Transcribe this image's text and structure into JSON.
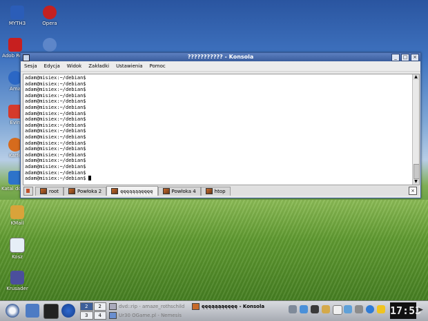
{
  "desktop": {
    "icons": [
      {
        "label": "MYTH3",
        "color": "#2b5db8"
      },
      {
        "label": "Opera",
        "color": "#c42121"
      },
      {
        "label": "Adob Read",
        "color": "#c71f1f"
      },
      {
        "label": "Ama",
        "color": "#2b67c5"
      },
      {
        "label": "Evin",
        "color": "#d53a2b"
      },
      {
        "label": "Kaffe",
        "color": "#d66b1d"
      },
      {
        "label": "Katal domu",
        "color": "#2d73c9"
      },
      {
        "label": "KMail",
        "color": "#d9a33a"
      },
      {
        "label": "Kosz",
        "color": "#e6eef7"
      },
      {
        "label": "Krusader",
        "color": "#4b4f9c"
      }
    ]
  },
  "window": {
    "title": "??????????? - Konsola",
    "menu": [
      "Sesja",
      "Edycja",
      "Widok",
      "Zakładki",
      "Ustawienia",
      "Pomoc"
    ],
    "terminal_lines": [
      "adam@misiex:~/debian$",
      "adam@misiex:~/debian$",
      "adam@misiex:~/debian$",
      "adam@misiex:~/debian$",
      "adam@misiex:~/debian$",
      "adam@misiex:~/debian$",
      "adam@misiex:~/debian$",
      "adam@misiex:~/debian$",
      "adam@misiex:~/debian$",
      "adam@misiex:~/debian$",
      "adam@misiex:~/debian$",
      "adam@misiex:~/debian$",
      "adam@misiex:~/debian$",
      "adam@misiex:~/debian$",
      "adam@misiex:~/debian$",
      "adam@misiex:~/debian$",
      "adam@misiex:~/debian$",
      "adam@misiex:~/debian$"
    ],
    "tabs": [
      {
        "label": "root",
        "active": false
      },
      {
        "label": "Powłoka 2",
        "active": false
      },
      {
        "label": "ęęęąąąąęęęę",
        "active": true
      },
      {
        "label": "Powłoka 4",
        "active": false
      },
      {
        "label": "htop",
        "active": false
      }
    ]
  },
  "taskbar": {
    "pager": [
      "2",
      "2",
      "3",
      "4"
    ],
    "tasks": [
      {
        "label": "dvd::rip - amaze_rothschild",
        "active": false
      },
      {
        "label": "Ur30 OGame.pl - Nemesis",
        "active": false
      },
      {
        "label": "ęęęąąąąęęęę - Konsola",
        "active": true
      }
    ],
    "clock": "17:53"
  }
}
